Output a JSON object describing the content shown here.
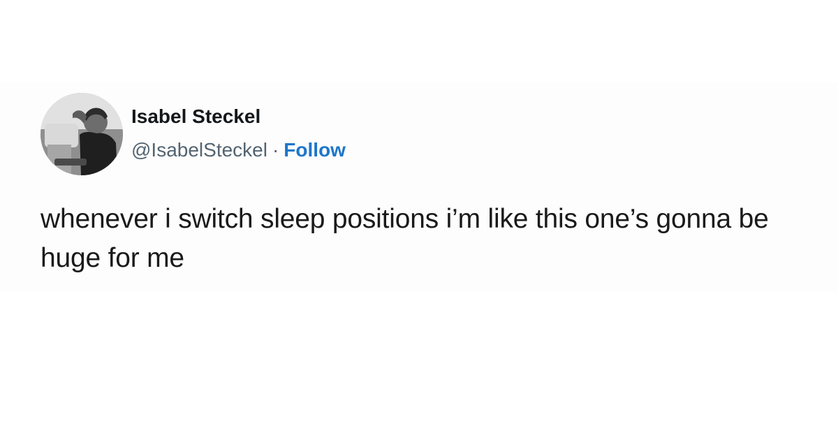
{
  "tweet": {
    "author": {
      "name": "Isabel Steckel",
      "handle": "@IsabelSteckel",
      "separator": "·",
      "follow_label": "Follow",
      "avatar_icon": "profile-photo-icon"
    },
    "text": "whenever i switch sleep positions i’m like this one’s gonna be huge for me"
  },
  "colors": {
    "background": "#ffffff",
    "card_background": "#fdfdfd",
    "name_text": "#14171a",
    "handle_text": "#536471",
    "follow_link": "#1d76c9",
    "body_text": "#1a1a1a"
  }
}
